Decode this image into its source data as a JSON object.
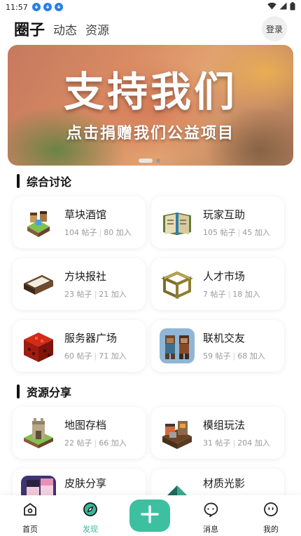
{
  "status_bar": {
    "time": "11:57"
  },
  "header": {
    "tabs": [
      {
        "label": "圈子",
        "active": true
      },
      {
        "label": "动态",
        "active": false
      },
      {
        "label": "资源",
        "active": false
      }
    ],
    "login_label": "登录"
  },
  "banner": {
    "title": "支持我们",
    "subtitle": "点击捐赠我们公益项目",
    "page_count": 2,
    "current_page": 1
  },
  "sections": [
    {
      "title": "综合讨论",
      "cards": [
        {
          "name": "草块酒馆",
          "posts": "104 帖子",
          "joins": "80 加入",
          "icon": "tavern-icon"
        },
        {
          "name": "玩家互助",
          "posts": "105 帖子",
          "joins": "45 加入",
          "icon": "book-icon"
        },
        {
          "name": "方块报社",
          "posts": "23 帖子",
          "joins": "21 加入",
          "icon": "newspaper-icon"
        },
        {
          "name": "人才市场",
          "posts": "7 帖子",
          "joins": "18 加入",
          "icon": "scaffold-icon"
        },
        {
          "name": "服务器广场",
          "posts": "60 帖子",
          "joins": "71 加入",
          "icon": "redstone-block-icon"
        },
        {
          "name": "联机交友",
          "posts": "59 帖子",
          "joins": "68 加入",
          "icon": "friends-icon"
        }
      ]
    },
    {
      "title": "资源分享",
      "cards": [
        {
          "name": "地图存档",
          "posts": "22 帖子",
          "joins": "66 加入",
          "icon": "map-icon"
        },
        {
          "name": "模组玩法",
          "posts": "31 帖子",
          "joins": "204 加入",
          "icon": "mod-icon"
        },
        {
          "name": "皮肤分享",
          "posts": "",
          "joins": "",
          "icon": "skin-icon"
        },
        {
          "name": "材质光影",
          "posts": "",
          "joins": "",
          "icon": "shader-icon"
        }
      ]
    }
  ],
  "tabbar": {
    "items": [
      {
        "label": "首页",
        "icon": "home-icon",
        "active": false
      },
      {
        "label": "发现",
        "icon": "compass-icon",
        "active": true
      },
      {
        "label": "消息",
        "icon": "message-icon",
        "active": false
      },
      {
        "label": "我的",
        "icon": "profile-icon",
        "active": false
      }
    ],
    "add_icon": "plus-icon"
  },
  "colors": {
    "accent": "#3dc0a0",
    "active_tab_text": "#35b99a",
    "muted_text": "#999999"
  }
}
